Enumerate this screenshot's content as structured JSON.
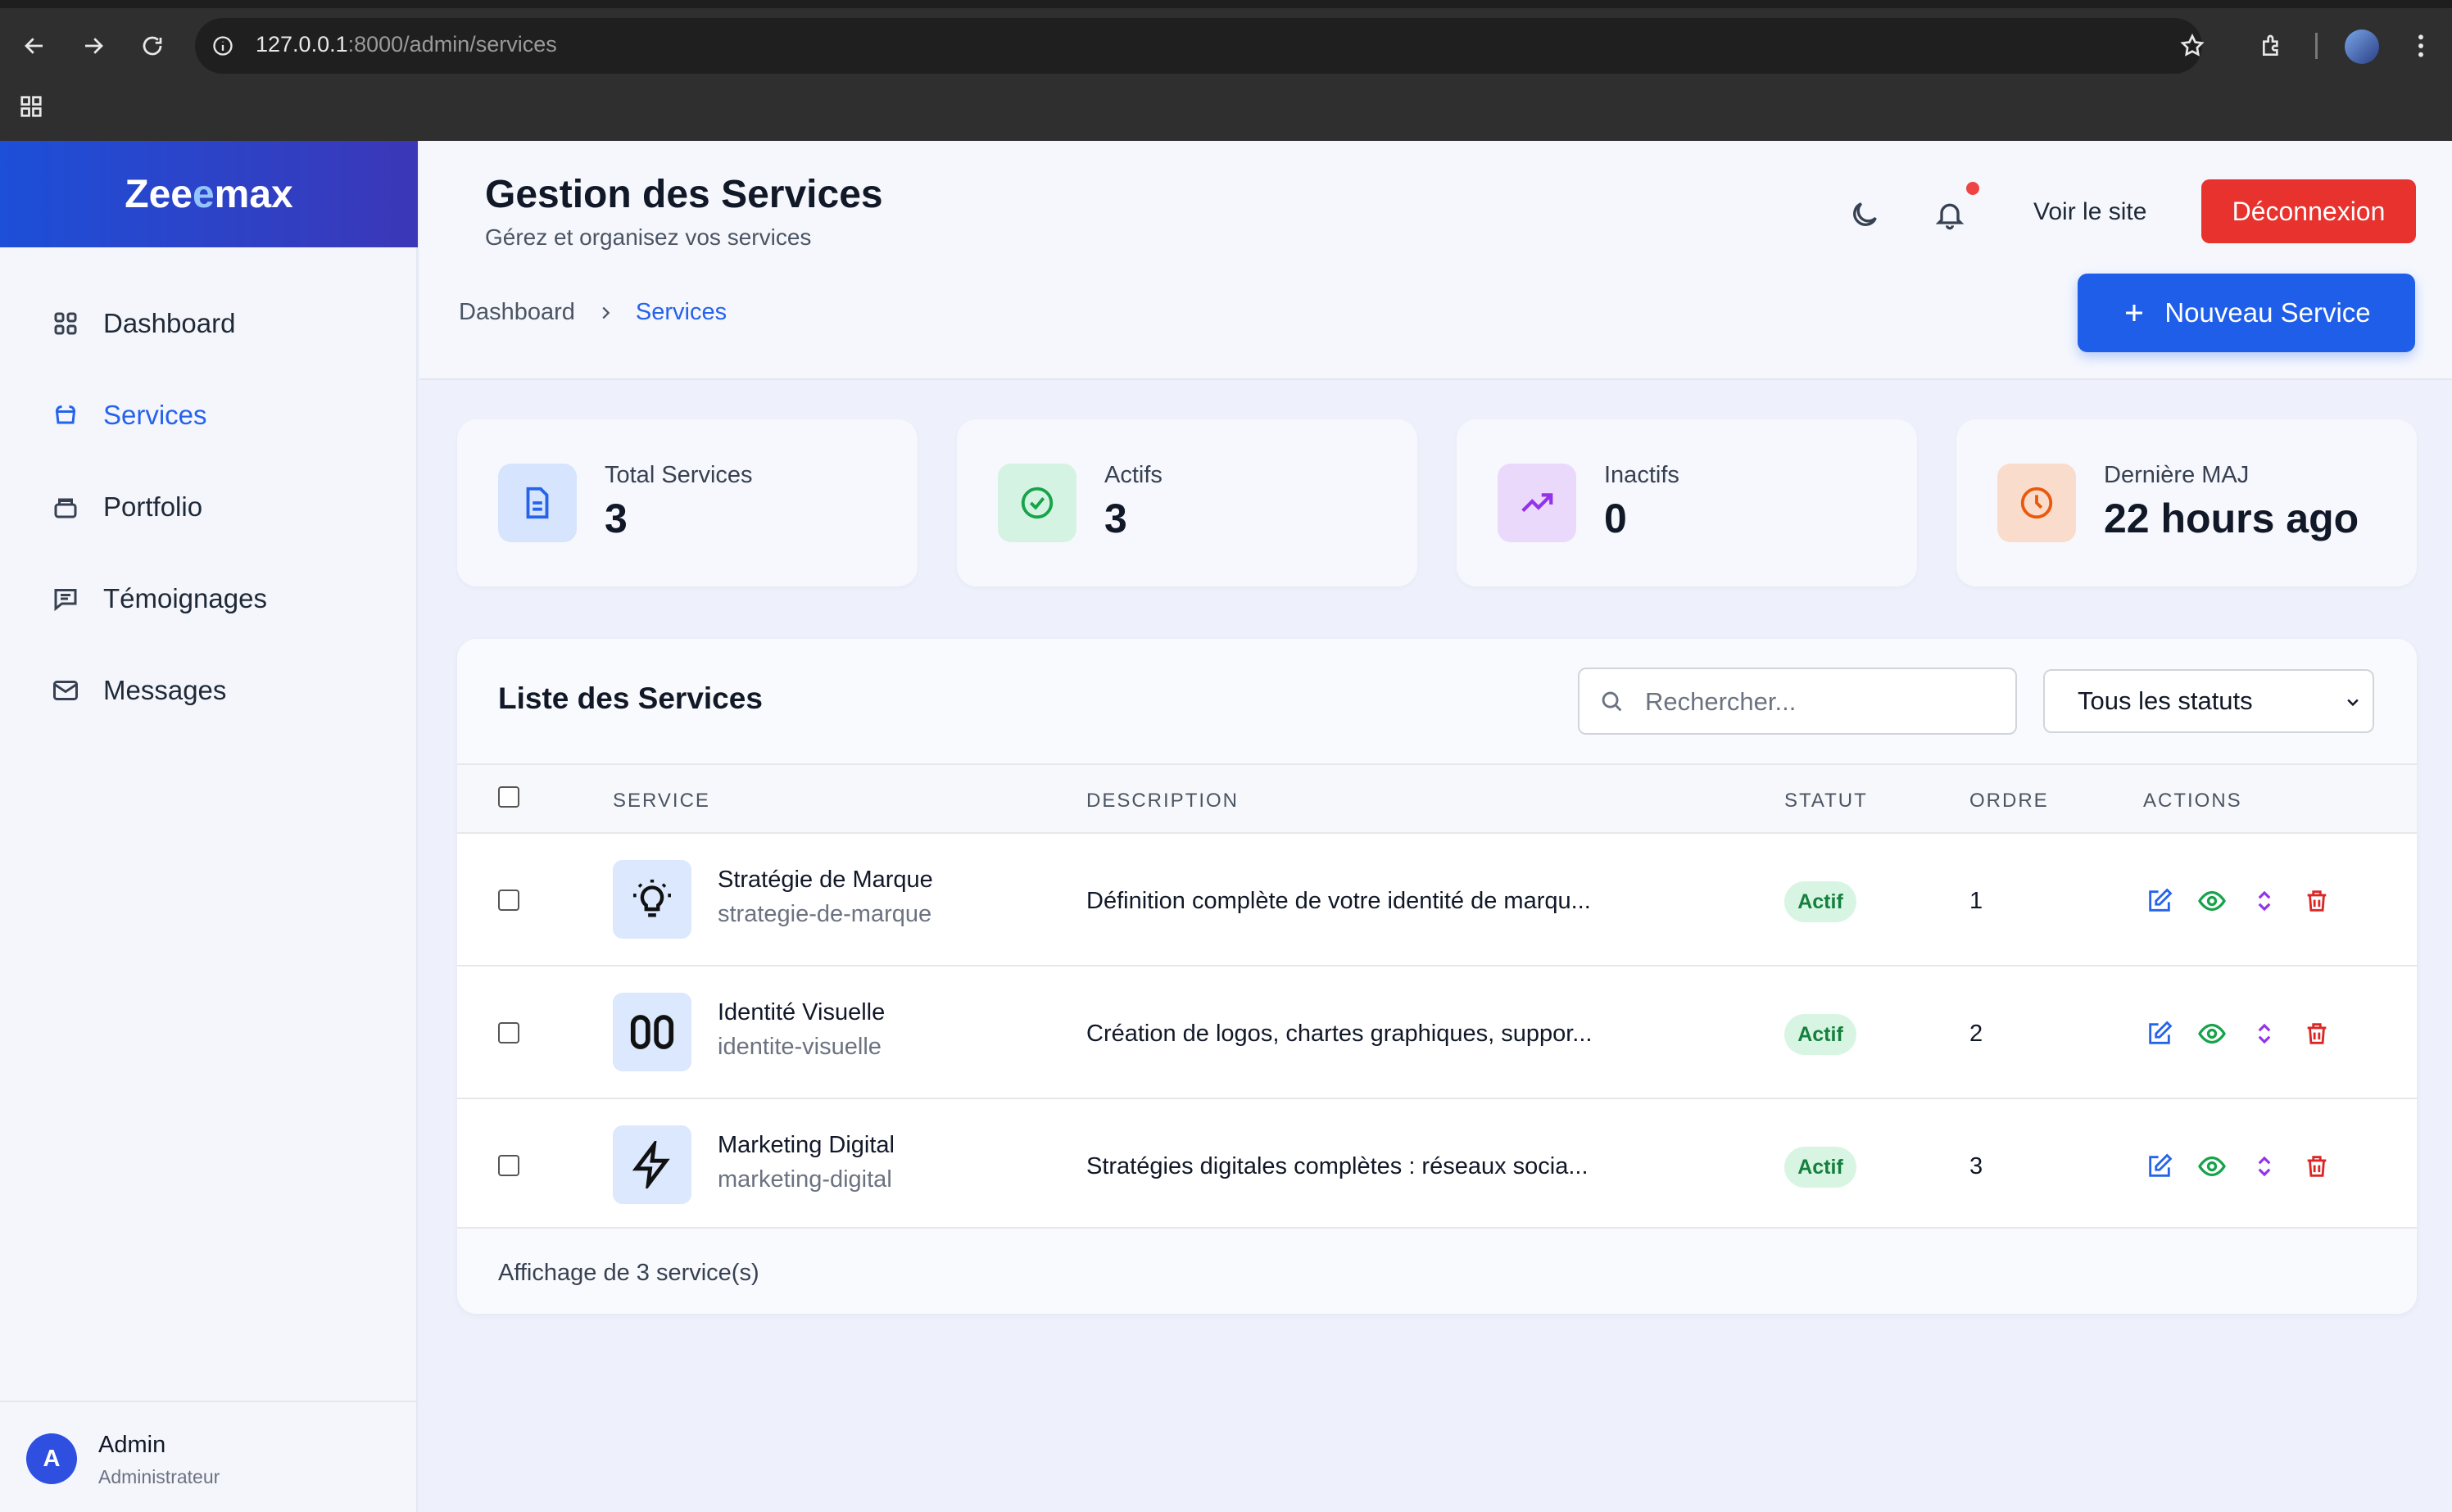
{
  "browser": {
    "url_host": "127.0.0.1",
    "url_path": ":8000/admin/services"
  },
  "sidebar": {
    "brand_a": "Zee",
    "brand_b": "e",
    "brand_c": "max",
    "items": [
      {
        "label": "Dashboard",
        "icon": "grid-icon"
      },
      {
        "label": "Services",
        "icon": "briefcase-icon",
        "active": true
      },
      {
        "label": "Portfolio",
        "icon": "folder-icon"
      },
      {
        "label": "Témoignages",
        "icon": "chat-icon"
      },
      {
        "label": "Messages",
        "icon": "mail-icon"
      }
    ],
    "user": {
      "initial": "A",
      "name": "Admin",
      "role": "Administrateur"
    }
  },
  "header": {
    "title": "Gestion des Services",
    "subtitle": "Gérez et organisez vos services",
    "view_site": "Voir le site",
    "logout": "Déconnexion",
    "new_service": "Nouveau Service",
    "breadcrumb": [
      "Dashboard",
      "Services"
    ]
  },
  "stats": [
    {
      "label": "Total Services",
      "value": "3",
      "icon": "document-icon",
      "bg": "#d6e4fd",
      "fg": "#2563eb"
    },
    {
      "label": "Actifs",
      "value": "3",
      "icon": "check-circle-icon",
      "bg": "#d5f3e2",
      "fg": "#16a34a"
    },
    {
      "label": "Inactifs",
      "value": "0",
      "icon": "trending-up-icon",
      "bg": "#ead9fb",
      "fg": "#9333ea"
    },
    {
      "label": "Dernière MAJ",
      "value": "22 hours ago",
      "icon": "clock-icon",
      "bg": "#fadccd",
      "fg": "#ea580c"
    }
  ],
  "table": {
    "title": "Liste des Services",
    "search_placeholder": "Rechercher...",
    "status_filter": "Tous les statuts",
    "columns": [
      "SERVICE",
      "DESCRIPTION",
      "STATUT",
      "ORDRE",
      "ACTIONS"
    ],
    "rows": [
      {
        "name": "Stratégie de Marque",
        "slug": "strategie-de-marque",
        "description": "Définition complète de votre identité de marqu...",
        "status": "Actif",
        "order": "1",
        "icon": "lightbulb-icon"
      },
      {
        "name": "Identité Visuelle",
        "slug": "identite-visuelle",
        "description": "Création de logos, chartes graphiques, suppor...",
        "status": "Actif",
        "order": "2",
        "icon": "columns-icon"
      },
      {
        "name": "Marketing Digital",
        "slug": "marketing-digital",
        "description": "Stratégies digitales complètes : réseaux socia...",
        "status": "Actif",
        "order": "3",
        "icon": "lightning-icon"
      }
    ],
    "footer": "Affichage de 3 service(s)"
  },
  "colors": {
    "primary": "#1f5ee8",
    "danger": "#e8322e",
    "success": "#15803d"
  }
}
